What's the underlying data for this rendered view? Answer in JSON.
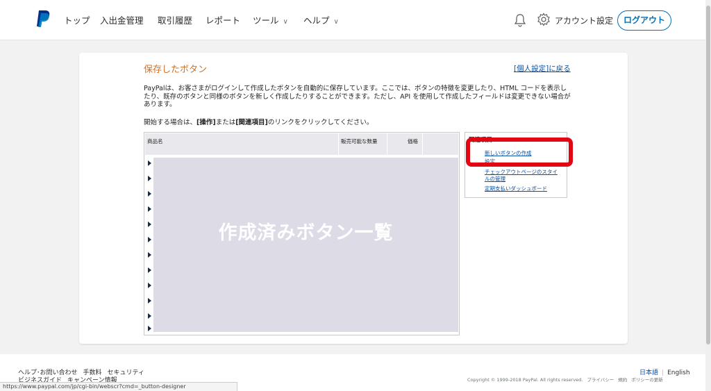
{
  "colors": {
    "accent": "#0070ba",
    "title_orange": "#d56e1f",
    "highlight_red": "#e30613",
    "placeholder_fill": "#dcdbe6"
  },
  "nav": {
    "items": [
      "トップ",
      "入出金管理",
      "取引履歴",
      "レポート",
      "ツール",
      "ヘルプ"
    ],
    "account_label": "アカウント設定",
    "logout_label": "ログアウト",
    "icons": [
      "paypal-logo",
      "bell-icon",
      "gear-icon",
      "chevron-down-icon"
    ]
  },
  "page": {
    "title": "保存したボタン",
    "back_link": "[個人設定]に戻る",
    "intro": "PayPalは、お客さまがログインして作成したボタンを自動的に保存しています。ここでは、ボタンの特徴を変更したり、HTML コードを表示したり、既存のボタンと同様のボタンを新しく作成したりすることができます。ただし、API を使用して作成したフィールドは変更できない場合があります。",
    "instruction_pre": "開始する場合は、",
    "instruction_b1": "[操作]",
    "instruction_mid": "または",
    "instruction_b2": "[関連項目]",
    "instruction_post": "のリンクをクリックしてください。"
  },
  "table": {
    "columns": [
      "商品名",
      "販売可能な数量",
      "価格"
    ],
    "row_count": 12,
    "overlay_label": "作成済みボタン一覧"
  },
  "related": {
    "title": "関連項目",
    "links": [
      "新しいボタンの作成",
      "設定",
      "チェックアウトページのスタイルの管理",
      "定期支払いダッシュボード"
    ]
  },
  "footer": {
    "left_row1": [
      "ヘルプ･お問い合わせ",
      "手数料",
      "セキュリティ"
    ],
    "left_row2": [
      "ビジネスガイド",
      "キャンペーン情報"
    ],
    "lang_ja": "日本語",
    "lang_en": "English",
    "copyright": "Copyright © 1999-2018 PayPal. All rights reserved.",
    "legal_links": [
      "プライバシー",
      "規約",
      "ポリシーの更新"
    ],
    "status_url": "https://www.paypal.com/jp/cgi-bin/webscr?cmd=_button-designer"
  }
}
